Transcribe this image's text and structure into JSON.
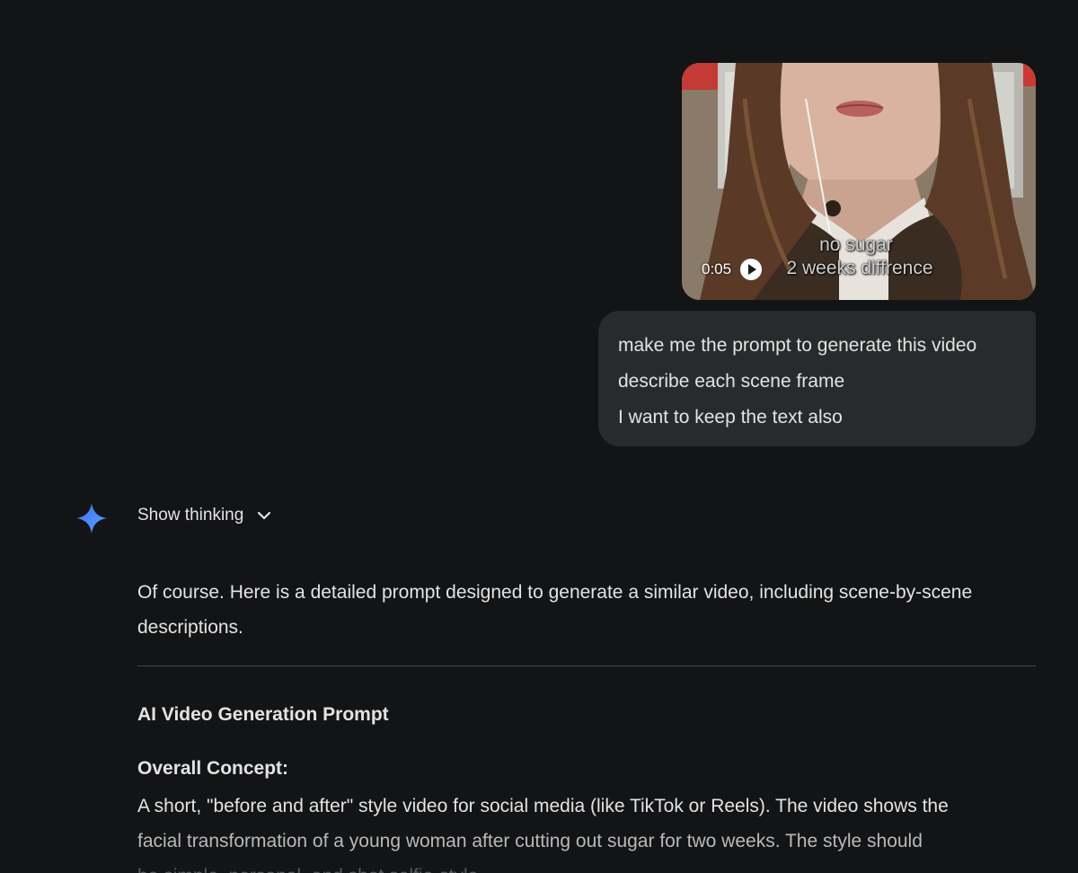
{
  "video": {
    "duration": "0:05",
    "caption_line1": "no sugar",
    "caption_line2": "2 weeks diffrence"
  },
  "user_message": {
    "lines": [
      "make me the prompt to generate this video",
      "describe each scene frame",
      "I want to keep the text also"
    ]
  },
  "assistant": {
    "show_thinking_label": "Show thinking",
    "intro": "Of course. Here is a detailed prompt designed to generate a similar video, including scene-by-scene descriptions.",
    "heading": "AI Video Generation Prompt",
    "subheading": "Overall Concept:",
    "paragraph_lines": [
      "A short, \"before and after\" style video for social media (like TikTok or Reels). The video shows the",
      "facial transformation of a young woman after cutting out sugar for two weeks. The style should",
      "be simple, personal, and shot selfie-style."
    ]
  },
  "colors": {
    "background": "#131416",
    "bubble": "#282a2c",
    "text": "#e3e3e3",
    "spark": "#4a8cf7"
  },
  "icons": [
    "play-icon",
    "gemini-spark-icon",
    "chevron-down-icon"
  ]
}
